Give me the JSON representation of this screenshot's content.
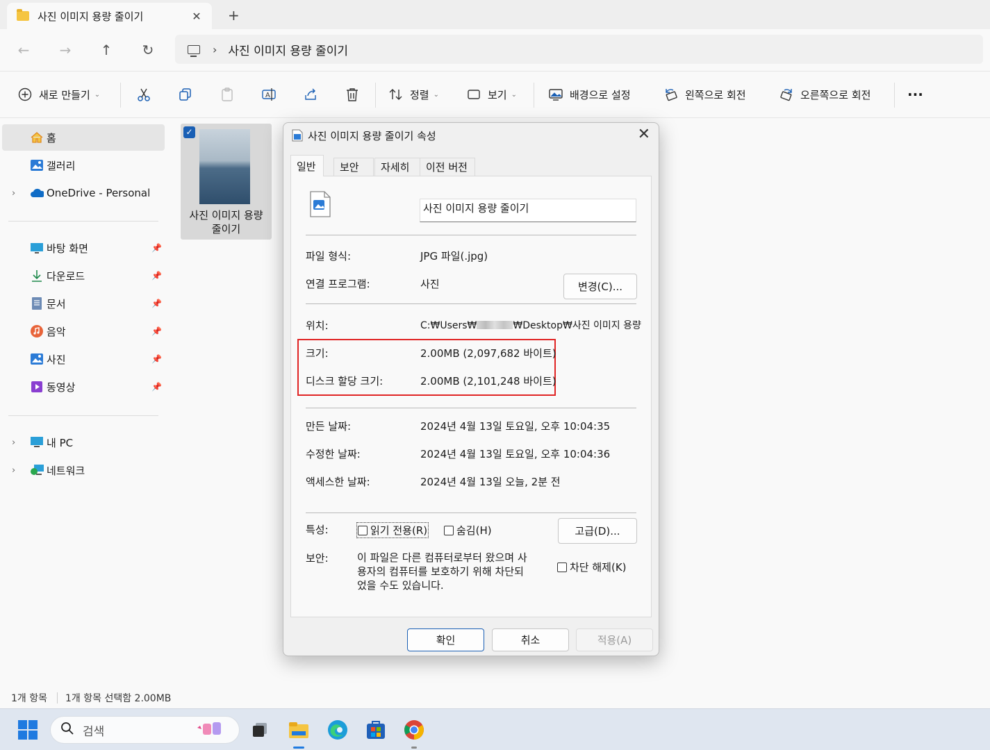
{
  "tab": {
    "title": "사진 이미지 용량 줄이기",
    "close": "✕",
    "new": "+"
  },
  "address": {
    "separator": "›",
    "crumb": "사진 이미지 용량 줄이기"
  },
  "toolbar": {
    "new_label": "새로 만들기",
    "sort_label": "정렬",
    "view_label": "보기",
    "set_background": "배경으로 설정",
    "rotate_left": "왼쪽으로 회전",
    "rotate_right": "오른쪽으로 회전",
    "more": "···"
  },
  "sidebar": {
    "items": [
      {
        "label": "홈"
      },
      {
        "label": "갤러리"
      },
      {
        "label": "OneDrive - Personal"
      },
      {
        "label": "바탕 화면"
      },
      {
        "label": "다운로드"
      },
      {
        "label": "문서"
      },
      {
        "label": "음악"
      },
      {
        "label": "사진"
      },
      {
        "label": "동영상"
      },
      {
        "label": "내 PC"
      },
      {
        "label": "네트워크"
      }
    ]
  },
  "file": {
    "name_line1": "사진 이미지 용량",
    "name_line2": "줄이기",
    "checked": "✓"
  },
  "status": {
    "count": "1개 항목",
    "selected": "1개 항목 선택함 2.00MB"
  },
  "taskbar": {
    "search_placeholder": "검색"
  },
  "dialog": {
    "title": "사진 이미지 용량 줄이기 속성",
    "tabs": [
      "일반",
      "보안",
      "자세히",
      "이전 버전"
    ],
    "filename": "사진 이미지 용량 줄이기",
    "file_type_label": "파일 형식:",
    "file_type_value": "JPG 파일(.jpg)",
    "open_with_label": "연결 프로그램:",
    "open_with_value": "사진",
    "change_button": "변경(C)...",
    "location_label": "위치:",
    "location_value_pre": "C:₩Users₩",
    "location_value_post": "₩Desktop₩사진 이미지 용량",
    "size_label": "크기:",
    "size_value": "2.00MB (2,097,682 바이트)",
    "disk_size_label": "디스크 할당 크기:",
    "disk_size_value": "2.00MB (2,101,248 바이트)",
    "created_label": "만든 날짜:",
    "created_value": "2024년 4월 13일 토요일, 오후 10:04:35",
    "modified_label": "수정한 날짜:",
    "modified_value": "2024년 4월 13일 토요일, 오후 10:04:36",
    "accessed_label": "액세스한 날짜:",
    "accessed_value": "2024년 4월 13일 오늘, 2분 전",
    "attributes_label": "특성:",
    "readonly_label": "읽기 전용(R)",
    "hidden_label": "숨김(H)",
    "advanced_button": "고급(D)...",
    "security_label": "보안:",
    "security_text_1": "이 파일은 다른 컴퓨터로부터 왔으며 사",
    "security_text_2": "용자의 컴퓨터를 보호하기 위해 차단되",
    "security_text_3": "었을 수도 있습니다.",
    "unblock_label": "차단 해제(K)",
    "ok_button": "확인",
    "cancel_button": "취소",
    "apply_button": "적용(A)"
  },
  "colors": {
    "accent": "#1a5fb4",
    "highlight": "#e02424"
  }
}
